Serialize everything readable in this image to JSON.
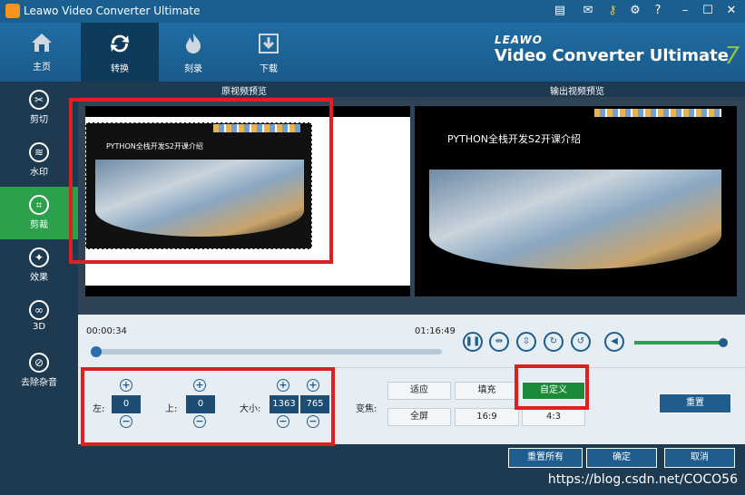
{
  "window": {
    "title": "Leawo Video Converter Ultimate"
  },
  "nav": [
    {
      "label": "主页",
      "icon": "home-icon"
    },
    {
      "label": "转换",
      "icon": "convert-icon"
    },
    {
      "label": "刻录",
      "icon": "burn-icon"
    },
    {
      "label": "下载",
      "icon": "download-icon"
    }
  ],
  "brand": {
    "line1": "LEAWO",
    "line2": "Video Converter Ultimate",
    "version": "7"
  },
  "sidebar": [
    {
      "label": "剪切",
      "icon": "scissors-icon"
    },
    {
      "label": "水印",
      "icon": "watermark-icon"
    },
    {
      "label": "剪裁",
      "icon": "crop-icon"
    },
    {
      "label": "效果",
      "icon": "effects-icon"
    },
    {
      "label": "3D",
      "icon": "3d-glasses-icon"
    },
    {
      "label": "去除杂音",
      "icon": "denoise-icon"
    }
  ],
  "preview": {
    "original_label": "原视频预览",
    "output_label": "输出视频预览",
    "video_caption": "PYTHON全栈开发S2开课介绍"
  },
  "playback": {
    "current_time": "00:00:34",
    "total_time": "01:16:49",
    "volume": 0.97
  },
  "crop": {
    "left_label": "左:",
    "left_value": "0",
    "top_label": "上:",
    "top_value": "0",
    "size_label": "大小:",
    "width_value": "1363",
    "height_value": "765",
    "zoom_label": "变焦:",
    "zoom_options": [
      "适应",
      "填充",
      "自定义",
      "全屏",
      "16:9",
      "4:3"
    ],
    "zoom_selected": "自定义",
    "reset_label": "重置"
  },
  "footer": {
    "reset_all": "重置所有",
    "ok": "确定",
    "cancel": "取消",
    "watermark": "https://blog.csdn.net/COCO56"
  },
  "colors": {
    "accent_green": "#2aa14a",
    "primary_blue": "#1f5d8f",
    "highlight_red": "#e02020"
  }
}
